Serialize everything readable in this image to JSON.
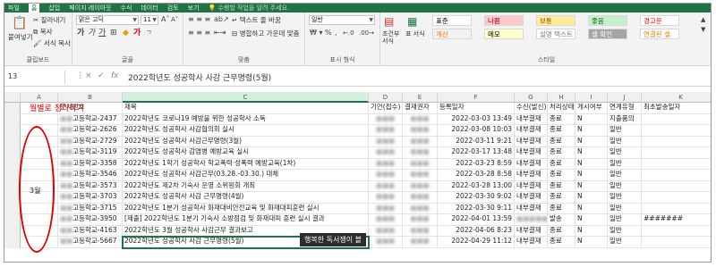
{
  "ribbon_tabs": [
    "파일",
    "홈",
    "삽입",
    "페이지 레이아웃",
    "수식",
    "데이터",
    "검토",
    "보기"
  ],
  "ribbon_tabs_active": 1,
  "tell_me": "수행할 작업을 알려 주세요.",
  "clipboard": {
    "paste": "붙여넣기",
    "cut": "잘라내기",
    "copy": "복사",
    "format_painter": "서식 복사",
    "label": "클립보드"
  },
  "font": {
    "name": "맑은 고딕",
    "size": "11",
    "label": "글꼴"
  },
  "alignment": {
    "wrap": "텍스트 줄 바꿈",
    "merge": "병합하고 가운데 맞춤",
    "label": "맞춤"
  },
  "number": {
    "format": "일반",
    "label": "표시 형식"
  },
  "cond_format": "조건부 서식",
  "table_format": "표 서식",
  "styles": {
    "label": "스타일",
    "items": [
      {
        "text": "표준",
        "bg": "#ffffff",
        "fg": "#000000"
      },
      {
        "text": "나쁨",
        "bg": "#ffc7ce",
        "fg": "#9c0006"
      },
      {
        "text": "보통",
        "bg": "#ffeb9c",
        "fg": "#9c5700"
      },
      {
        "text": "좋음",
        "bg": "#c6efce",
        "fg": "#006100"
      },
      {
        "text": "경고문",
        "bg": "#ffffff",
        "fg": "#ff0000"
      },
      {
        "text": "계산",
        "bg": "#f2f2f2",
        "fg": "#fa7d00"
      },
      {
        "text": "메모",
        "bg": "#ffffcc",
        "fg": "#000000"
      },
      {
        "text": "설명 텍스트",
        "bg": "#ffffff",
        "fg": "#7f7f7f"
      },
      {
        "text": "셀 확인",
        "bg": "#a5a5a5",
        "fg": "#ffffff"
      },
      {
        "text": "연결된 셀",
        "bg": "#ffffff",
        "fg": "#fa7d00"
      }
    ]
  },
  "formula_bar": {
    "name_box": "13",
    "cancel": "×",
    "enter": "✓",
    "fx": "fx",
    "content": "2022학년도 성공학사 사감 근무명령(5월)"
  },
  "columns": [
    {
      "letter": "A"
    },
    {
      "letter": "B"
    },
    {
      "letter": "C",
      "selected": true
    },
    {
      "letter": "D"
    },
    {
      "letter": "E"
    },
    {
      "letter": "F"
    },
    {
      "letter": "G"
    },
    {
      "letter": "H"
    },
    {
      "letter": "I"
    },
    {
      "letter": "J"
    },
    {
      "letter": "K"
    }
  ],
  "header_row": {
    "b": "문서번호",
    "c": "제목",
    "d": "기안(접수)",
    "e": "결재권자",
    "f": "등록일자",
    "g": "수신(발신)",
    "h": "처리상태",
    "i": "게시여부",
    "j": "연계유형",
    "k": "최초발송일자"
  },
  "annotation_text": "월별로 정리하기",
  "month_label": "3월",
  "rows": [
    {
      "b": "고등학교-2437",
      "c": "2022학년도 코로나19 예방을 위한 성공학사 소독",
      "f": "2022-03-03 13:49",
      "g": "내부결재",
      "h": "종료",
      "i": "N",
      "j": "지출품의",
      "k": ""
    },
    {
      "b": "고등학교-2626",
      "c": "2022학년도 성공학사 사감협의회 실시",
      "f": "2022-03-08 10:03",
      "g": "내부결재",
      "h": "종료",
      "i": "N",
      "j": "일반",
      "k": ""
    },
    {
      "b": "고등학교-2729",
      "c": "2022학년도 성공학사 사감근무명령(3월)",
      "f": "2022-03-11 9:21",
      "g": "내부결재",
      "h": "종료",
      "i": "N",
      "j": "일반",
      "k": ""
    },
    {
      "b": "고등학교-3119",
      "c": "2022학년도 성공학사 감염병 예방교육 실시",
      "f": "2022-03-17 13:48",
      "g": "내부결재",
      "h": "종료",
      "i": "N",
      "j": "일반",
      "k": ""
    },
    {
      "b": "고등학교-3358",
      "c": "2022학년도 1학기 성공학사 학교폭력·성폭력 예방교육(1차)",
      "f": "2022-03-23 8:59",
      "g": "내부결재",
      "h": "종료",
      "i": "N",
      "j": "일반",
      "k": ""
    },
    {
      "b": "고등학교-3546",
      "c": "2022학년도 성공학사 사감근무(03.28.-03.30.) 대체",
      "f": "2022-03-28 8:58",
      "g": "내부결재",
      "h": "종료",
      "i": "N",
      "j": "일반",
      "k": ""
    },
    {
      "b": "고등학교-3573",
      "c": "2022학년도 제2차 기숙사 운영 소위원회 개최",
      "f": "2022-03-28 13:00",
      "g": "내부결재",
      "h": "종료",
      "i": "N",
      "j": "일반",
      "k": ""
    },
    {
      "b": "고등학교-3703",
      "c": "2022학년도 성공학사 사감 근무명령(4월)",
      "f": "2022-03-30 9:02",
      "g": "내부결재",
      "h": "종료",
      "i": "N",
      "j": "일반",
      "k": ""
    },
    {
      "b": "고등학교-3715",
      "c": "2022학년도 1분기 성공학사 화재대비안전교육 및 화재대피훈련 실시",
      "f": "2022-03-30 9:11",
      "g": "내부결재",
      "h": "종료",
      "i": "N",
      "j": "일반",
      "k": ""
    },
    {
      "b": "고등학교-3950",
      "c": "[제출] 2022학년도 1분기 기숙사 소방점검 및 화재대피 훈련 실시 결과",
      "f": "2022-04-01 13:59",
      "g": "",
      "h": "발송",
      "i": "N",
      "j": "일반",
      "k": "#######"
    },
    {
      "b": "고등학교-4163",
      "c": "2022학년도 3월 성공학사 사감근무 결과보고",
      "f": "2022-04-06 8:23",
      "g": "내부결재",
      "h": "종료",
      "i": "N",
      "j": "일반",
      "k": ""
    },
    {
      "b": "고등학교-5667",
      "c": "2022학년도 성공학사 사감 근무명령(5월)",
      "f": "2022-04-29 11:12",
      "g": "내부결재",
      "h": "종료",
      "i": "N",
      "j": "일반",
      "k": ""
    }
  ],
  "toast": "행복한 독서쟁이 블"
}
